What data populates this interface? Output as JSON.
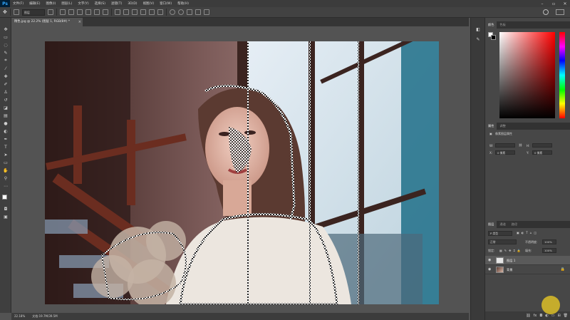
{
  "app": {
    "logo": "Ps"
  },
  "menu": [
    "文件(F)",
    "编辑(E)",
    "图像(I)",
    "图层(L)",
    "文字(Y)",
    "选择(S)",
    "滤镜(T)",
    "3D(D)",
    "视图(V)",
    "窗口(W)",
    "帮助(H)"
  ],
  "options": {
    "mode_value": "图层"
  },
  "document": {
    "tab_title": "精色.jpg @ 22.2% (图层 1, RGB/8#) *"
  },
  "status": {
    "zoom": "22.18%",
    "doc_info": "文档:19.7M/39.5M"
  },
  "color_panel": {
    "tabs": [
      "颜色",
      "色板"
    ]
  },
  "properties_panel": {
    "tabs": [
      "属性",
      "调整"
    ],
    "title": "像素图层属性",
    "w_label": "W:",
    "w_value": "",
    "h_label": "H:",
    "h_value": "",
    "x_label": "X:",
    "x_value": "0 像素",
    "y_label": "Y:",
    "y_value": "0 像素"
  },
  "layers_panel": {
    "tabs": [
      "图层",
      "通道",
      "路径"
    ],
    "filter_value": "P 类型",
    "blend_mode": "正常",
    "opacity_label": "不透明度:",
    "opacity_value": "100%",
    "lock_label": "锁定:",
    "fill_label": "填充:",
    "fill_value": "100%",
    "layers": [
      {
        "name": "图层 1",
        "active": true
      },
      {
        "name": "背景",
        "active": false
      }
    ]
  },
  "colors": {
    "accent": "#31a8ff",
    "cursor": "#dcbe28"
  }
}
